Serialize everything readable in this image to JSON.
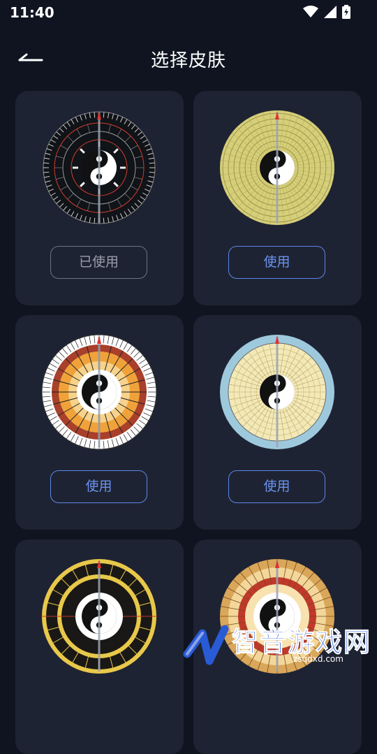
{
  "status_bar": {
    "time": "11:40"
  },
  "header": {
    "title": "选择皮肤"
  },
  "skins": [
    {
      "button_label": "已使用",
      "used": true,
      "style": "dark",
      "colors": [
        "#101318",
        "#d23d2e",
        "#e8e8e8"
      ]
    },
    {
      "button_label": "使用",
      "used": false,
      "style": "khaki",
      "colors": [
        "#d6cf7a",
        "#b8ae52",
        "#8c8440"
      ]
    },
    {
      "button_label": "使用",
      "used": false,
      "style": "orange",
      "colors": [
        "#ffffff",
        "#a8402b",
        "#f0a23a"
      ]
    },
    {
      "button_label": "使用",
      "used": false,
      "style": "lightblue",
      "colors": [
        "#9ec9dd",
        "#f3e9b8",
        "#d9c887"
      ]
    },
    {
      "button_label": "",
      "used": false,
      "style": "black-gold",
      "colors": [
        "#1a1816",
        "#e8c84a",
        "#c0392b"
      ]
    },
    {
      "button_label": "",
      "used": false,
      "style": "tan",
      "colors": [
        "#d9a75a",
        "#c0392b",
        "#f3d79a"
      ]
    }
  ],
  "watermark": {
    "text": "智音游戏网",
    "sub": "zsqdxd.com"
  },
  "accent": "#5c86e6"
}
